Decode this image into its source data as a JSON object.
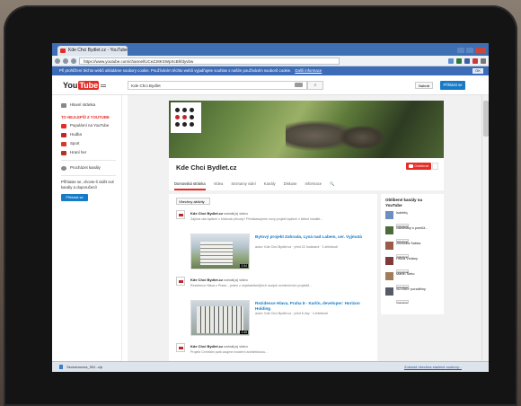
{
  "browser": {
    "tab_title": "Kde Chci Bydlet.cz - YouTube",
    "url": "https://www.youtube.com/channel/UCeZJ8KSWpXcBhfdyvbw",
    "infobar_text": "Při prohlížení těchto webů ukládáme soubory cookie. Používáním těchto webů vyjadřujete souhlas s naším používáním souborů cookie.",
    "infobar_link": "Další informace",
    "infobar_ok": "OK"
  },
  "youtube": {
    "logo_you": "You",
    "logo_tube": "Tube",
    "search_value": "Kde Chci Bydlet",
    "search_icon": "search-icon",
    "upload_label": "Nahrát",
    "signin_label": "Přihlásit se"
  },
  "sidebar": {
    "home": "Hlavní stránka",
    "best_header": "TO NEJLEPŠÍ Z YOUTUBE",
    "items": [
      {
        "label": "Populární na YouTube",
        "color": "#e52d27"
      },
      {
        "label": "Hudba",
        "color": "#c0272d"
      },
      {
        "label": "Sport",
        "color": "#d43a2a"
      },
      {
        "label": "Hraní her",
        "color": "#b5322b"
      }
    ],
    "browse": "Procházet kanály",
    "signin_text": "Přihlaste se, chcete-li vidět své kanály a doporučení!",
    "signin_btn": "Přihlásit se"
  },
  "channel": {
    "name": "Kde Chci Bydlet.cz",
    "subscribe": "Odebírat",
    "tabs": [
      "Domovská stránka",
      "Videa",
      "Seznamy videí",
      "Kanály",
      "Diskuse",
      "Informace",
      "🔍"
    ],
    "filter": "Všechny aktivity"
  },
  "feed": [
    {
      "author": "Kde Chci Bydlet.cz",
      "action": "nahrál(a) video",
      "desc": "Zajímá vás bydlení v blízkosti přírody? Představujeme nový projekt bydlení v klidné lokalitě...",
      "title": "Bytový projekt Zahrada, Lysá nad Labem, cer. Vyjmutá",
      "meta": "autor: Kde Chci Bydlet.cz · před 22 hodinami · 3 zhlédnutí",
      "duration": "2:54"
    },
    {
      "author": "Kde Chci Bydlet.cz",
      "action": "nahrál(a) video",
      "desc": "Rezidence Hlava v Praze – jeden z nejatraktivnějších nových rezidenčních projektů...",
      "title": "Rezidence Hlava, Praha 8 - Karlín, developer: Horizon Holding",
      "meta": "autor: Kde Chci Bydlet.cz · před 6 dny · 4 zhlédnutí",
      "duration": "1:45"
    },
    {
      "author": "Kde Chci Bydlet.cz",
      "action": "nahrál(a) video",
      "desc": "Projekt Centrální park zaujme moderní architekturou...",
      "title": "",
      "meta": "",
      "duration": ""
    }
  ],
  "rail": {
    "title": "Oblíbené kanály na YouTube",
    "subscribe": "Odebírat",
    "channels": [
      {
        "name": "Isdnhfq",
        "color": "#6d8fbf"
      },
      {
        "name": "Náměstky s pomůž...",
        "color": "#4d6b3a"
      },
      {
        "name": "Zlichodia Sabba",
        "color": "#9a5b4a"
      },
      {
        "name": "Hrůza Vzdány",
        "color": "#7f3b3b"
      },
      {
        "name": "Martin Šebo",
        "color": "#a07c58"
      },
      {
        "name": "SLOSBY poradělny",
        "color": "#555a66"
      }
    ]
  },
  "statusbar": {
    "file": "Seznamovna_SM...zip",
    "right": "Zobrazit všechna stažené soubory..."
  }
}
